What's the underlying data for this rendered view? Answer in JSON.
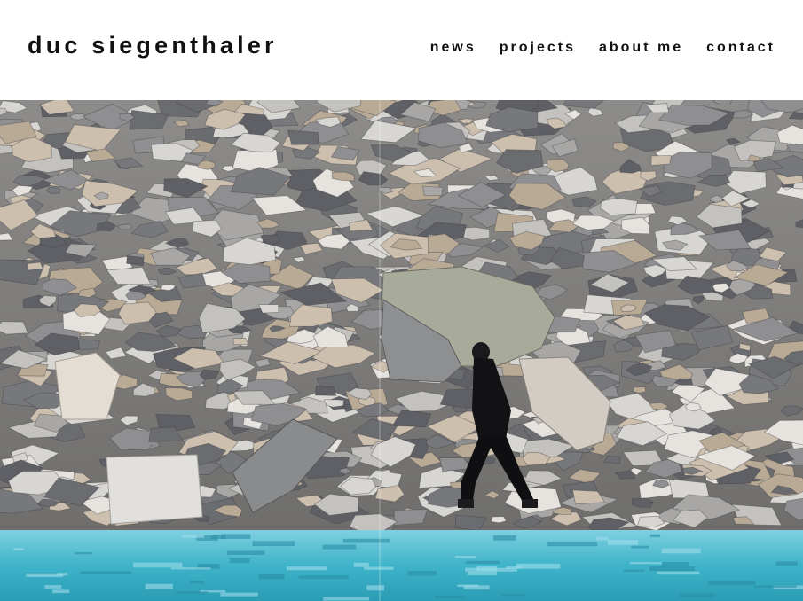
{
  "site": {
    "title": "duc siegenthaler"
  },
  "nav": {
    "items": [
      {
        "label": "news"
      },
      {
        "label": "projects"
      },
      {
        "label": "about me"
      },
      {
        "label": "contact"
      }
    ]
  },
  "hero": {
    "colors": {
      "rock_light": "#d8d6d2",
      "rock_mid": "#9a9a9c",
      "rock_dark": "#5a5b60",
      "rock_warm": "#c9b9a4",
      "water": "#3fb3c9",
      "water_light": "#9fdcea",
      "person": "#121214"
    }
  }
}
